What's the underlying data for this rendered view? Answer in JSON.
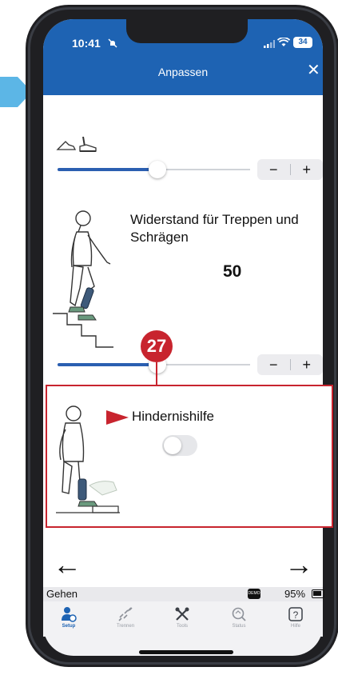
{
  "status_bar": {
    "time": "10:41",
    "battery": "34"
  },
  "header": {
    "title": "Anpassen",
    "close": "✕"
  },
  "slider1": {
    "value_fraction": 0.52,
    "minus": "−",
    "plus": "+"
  },
  "resistance": {
    "label": "Widerstand für Treppen und Schrägen",
    "value": "50"
  },
  "slider2": {
    "value_fraction": 0.52,
    "minus": "−",
    "plus": "+"
  },
  "callout": {
    "number": "27"
  },
  "obstacle": {
    "label": "Hindernishilfe",
    "enabled": false
  },
  "nav": {
    "back": "←",
    "forward": "→"
  },
  "device_status": {
    "mode": "Gehen",
    "demo_icon": "DEMO",
    "battery_percent": "95%"
  },
  "tabs": [
    {
      "label": "Setup",
      "icon": "user-settings-icon",
      "active": true
    },
    {
      "label": "Trennen",
      "icon": "disconnect-icon",
      "active": false
    },
    {
      "label": "Tools",
      "icon": "tools-icon",
      "active": false
    },
    {
      "label": "Status",
      "icon": "status-search-icon",
      "active": false
    },
    {
      "label": "Hilfe",
      "icon": "help-icon",
      "active": false
    }
  ],
  "colors": {
    "header_blue": "#1e63b3",
    "accent_red": "#c8242e",
    "slider_fill": "#2b5fb1",
    "marker_blue": "#5cb6e6"
  }
}
